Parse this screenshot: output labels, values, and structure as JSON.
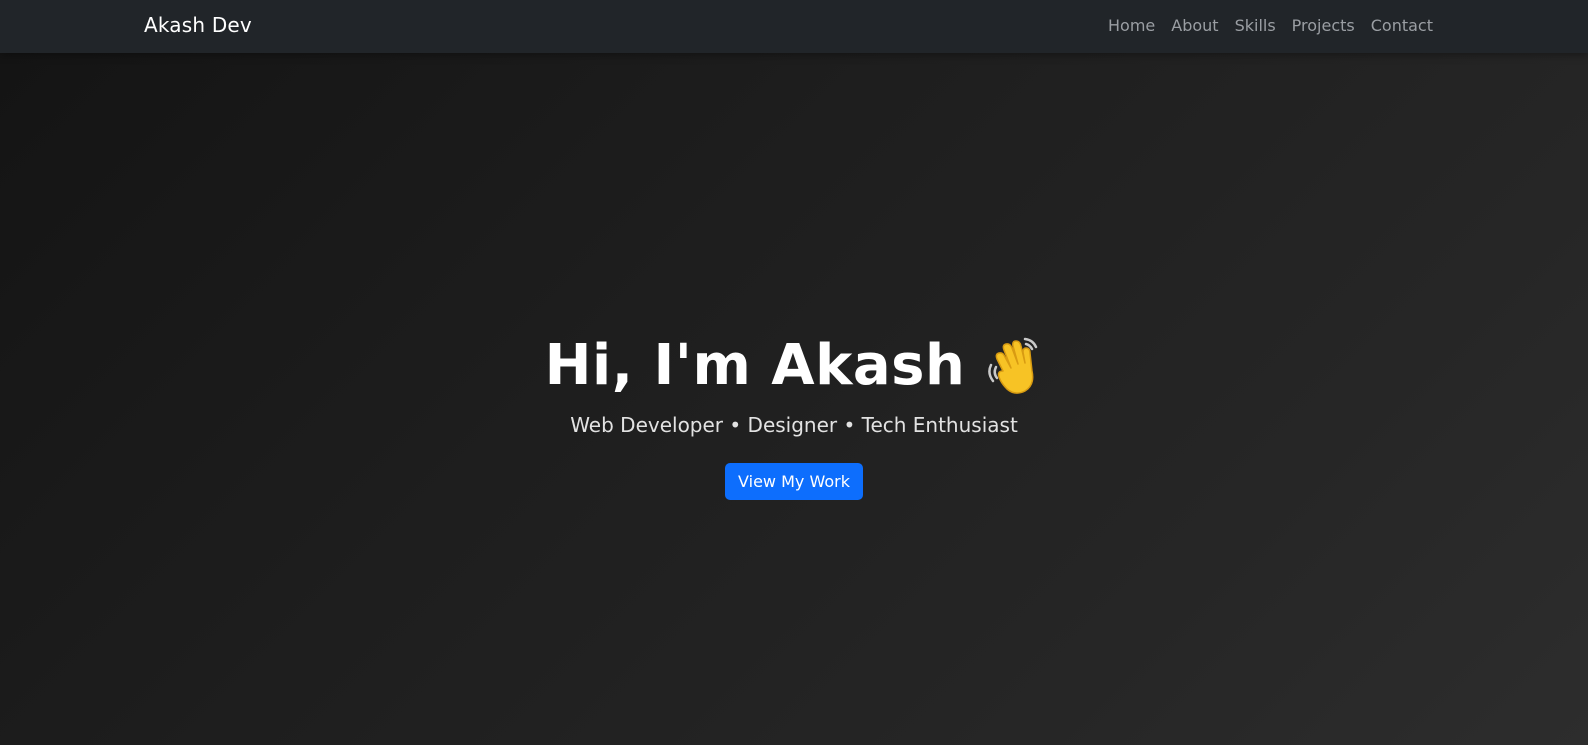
{
  "navbar": {
    "brand": "Akash Dev",
    "links": [
      "Home",
      "About",
      "Skills",
      "Projects",
      "Contact"
    ]
  },
  "hero": {
    "title": "Hi, I'm Akash",
    "icon": "waving-hand-icon",
    "subtitle": "Web Developer • Designer • Tech Enthusiast",
    "cta_label": "View My Work"
  },
  "colors": {
    "navbar_bg": "#212529",
    "accent": "#0d6efd",
    "nav_link": "#9a9ea3",
    "hero_text": "#ffffff"
  }
}
